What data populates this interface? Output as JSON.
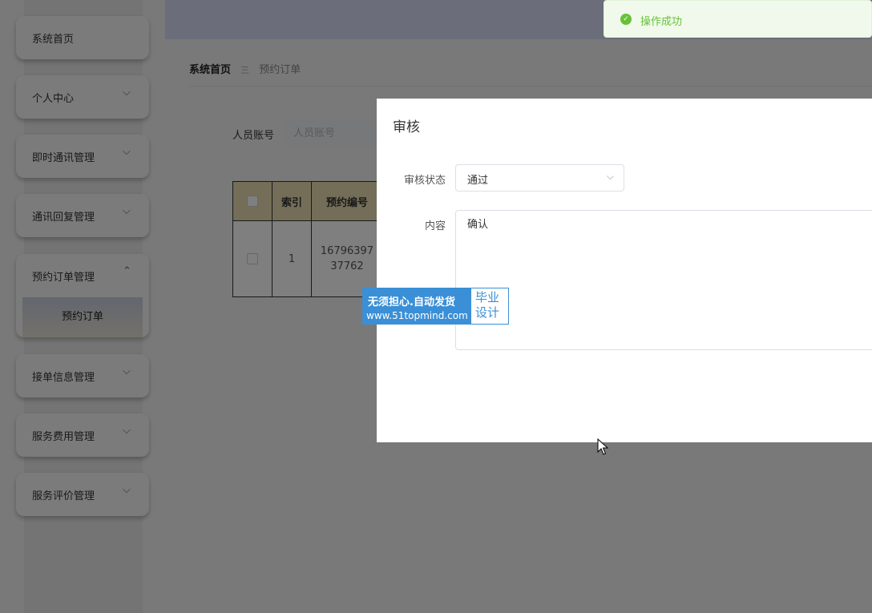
{
  "sidebar": {
    "items": [
      {
        "label": "系统首页",
        "chevron": ""
      },
      {
        "label": "个人中心",
        "chevron": "⌵"
      },
      {
        "label": "即时通讯管理",
        "chevron": "⌵"
      },
      {
        "label": "通讯回复管理",
        "chevron": "⌵"
      },
      {
        "label": "预约订单管理",
        "chevron": "⌃"
      },
      {
        "label": "接单信息管理",
        "chevron": "⌵"
      },
      {
        "label": "服务费用管理",
        "chevron": "⌵"
      },
      {
        "label": "服务评价管理",
        "chevron": "⌵"
      }
    ],
    "submenu": {
      "label": "预约订单"
    }
  },
  "breadcrumb": {
    "home": "系统首页",
    "separator": "三",
    "current": "预约订单"
  },
  "search": {
    "label": "人员账号",
    "placeholder": "人员账号",
    "value": ""
  },
  "table": {
    "headers": [
      "",
      "索引",
      "预约编号"
    ],
    "rows": [
      {
        "index": "1",
        "order_no_line1": "16796397",
        "order_no_line2": "37762"
      }
    ]
  },
  "toast": {
    "message": "操作成功",
    "icon": "check-circle-icon",
    "color": "#67c23a"
  },
  "dialog": {
    "title": "审核",
    "status_label": "审核状态",
    "status_value": "通过",
    "content_label": "内容",
    "content_value": "确认"
  },
  "watermark": {
    "line1": "无须担心.自动发货",
    "line2": "www.51topmind.com",
    "right_line1": "毕业",
    "right_line2": "设计"
  },
  "colors": {
    "header_row": "#e9ddb3",
    "topbar": "#d6dcf4",
    "watermark_blue": "#3a8fd6"
  }
}
